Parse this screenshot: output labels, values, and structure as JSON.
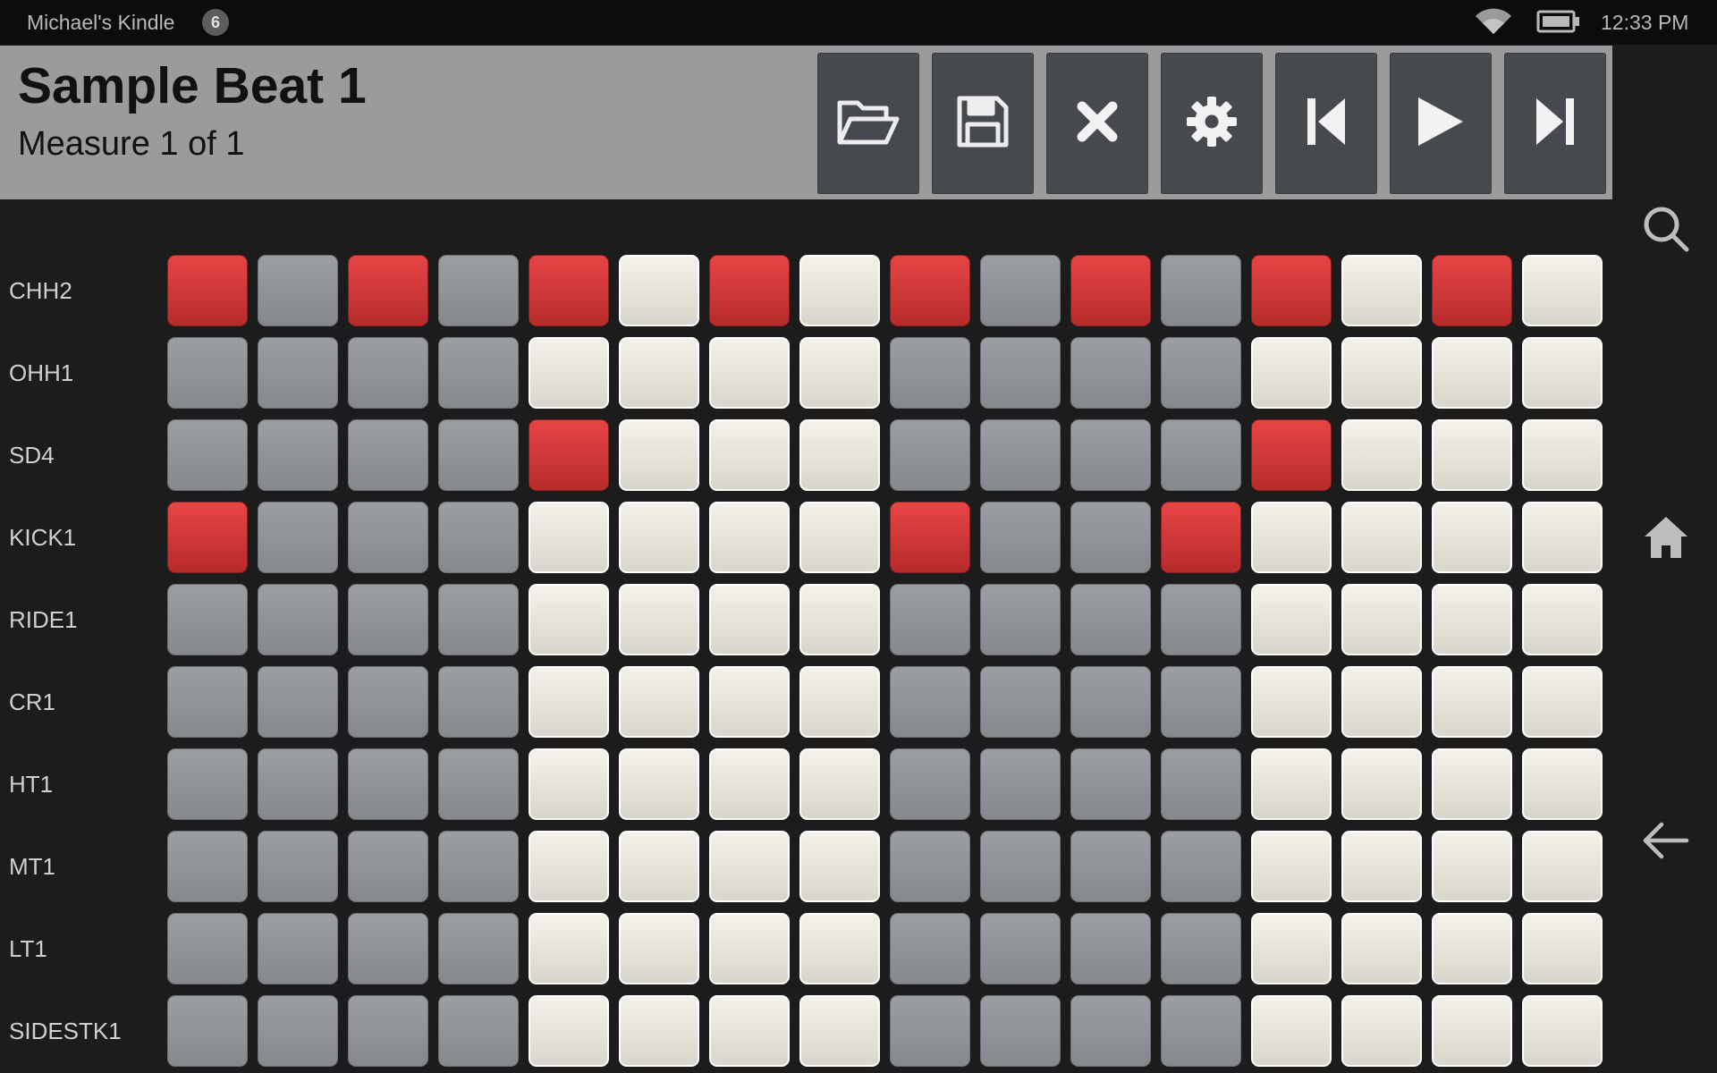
{
  "status_bar": {
    "device_name": "Michael's Kindle",
    "notification_count": "6",
    "time": "12:33 PM"
  },
  "header": {
    "title": "Sample Beat 1",
    "measure": "Measure 1 of 1"
  },
  "toolbar": [
    {
      "name": "open-button",
      "icon": "folder-open-icon"
    },
    {
      "name": "save-button",
      "icon": "floppy-disk-icon"
    },
    {
      "name": "clear-button",
      "icon": "close-icon"
    },
    {
      "name": "settings-button",
      "icon": "gear-icon"
    },
    {
      "name": "skip-back-button",
      "icon": "skip-back-icon"
    },
    {
      "name": "play-button",
      "icon": "play-icon"
    },
    {
      "name": "skip-forward-button",
      "icon": "skip-forward-icon"
    }
  ],
  "nav": [
    {
      "name": "search-button",
      "icon": "search-icon"
    },
    {
      "name": "home-button",
      "icon": "home-icon"
    },
    {
      "name": "back-button",
      "icon": "back-arrow-icon"
    }
  ],
  "colors": {
    "active_step": "#d93a3a",
    "beat_step_dark": "#8f9297",
    "beat_step_light": "#e8e6dc"
  },
  "tracks": [
    {
      "name": "CHH2",
      "steps": [
        1,
        0,
        1,
        0,
        1,
        0,
        1,
        0,
        1,
        0,
        1,
        0,
        1,
        0,
        1,
        0
      ]
    },
    {
      "name": "OHH1",
      "steps": [
        0,
        0,
        0,
        0,
        0,
        0,
        0,
        0,
        0,
        0,
        0,
        0,
        0,
        0,
        0,
        0
      ]
    },
    {
      "name": "SD4",
      "steps": [
        0,
        0,
        0,
        0,
        1,
        0,
        0,
        0,
        0,
        0,
        0,
        0,
        1,
        0,
        0,
        0
      ]
    },
    {
      "name": "KICK1",
      "steps": [
        1,
        0,
        0,
        0,
        0,
        0,
        0,
        0,
        1,
        0,
        0,
        1,
        0,
        0,
        0,
        0
      ]
    },
    {
      "name": "RIDE1",
      "steps": [
        0,
        0,
        0,
        0,
        0,
        0,
        0,
        0,
        0,
        0,
        0,
        0,
        0,
        0,
        0,
        0
      ]
    },
    {
      "name": "CR1",
      "steps": [
        0,
        0,
        0,
        0,
        0,
        0,
        0,
        0,
        0,
        0,
        0,
        0,
        0,
        0,
        0,
        0
      ]
    },
    {
      "name": "HT1",
      "steps": [
        0,
        0,
        0,
        0,
        0,
        0,
        0,
        0,
        0,
        0,
        0,
        0,
        0,
        0,
        0,
        0
      ]
    },
    {
      "name": "MT1",
      "steps": [
        0,
        0,
        0,
        0,
        0,
        0,
        0,
        0,
        0,
        0,
        0,
        0,
        0,
        0,
        0,
        0
      ]
    },
    {
      "name": "LT1",
      "steps": [
        0,
        0,
        0,
        0,
        0,
        0,
        0,
        0,
        0,
        0,
        0,
        0,
        0,
        0,
        0,
        0
      ]
    },
    {
      "name": "SIDESTK1",
      "steps": [
        0,
        0,
        0,
        0,
        0,
        0,
        0,
        0,
        0,
        0,
        0,
        0,
        0,
        0,
        0,
        0
      ]
    }
  ]
}
